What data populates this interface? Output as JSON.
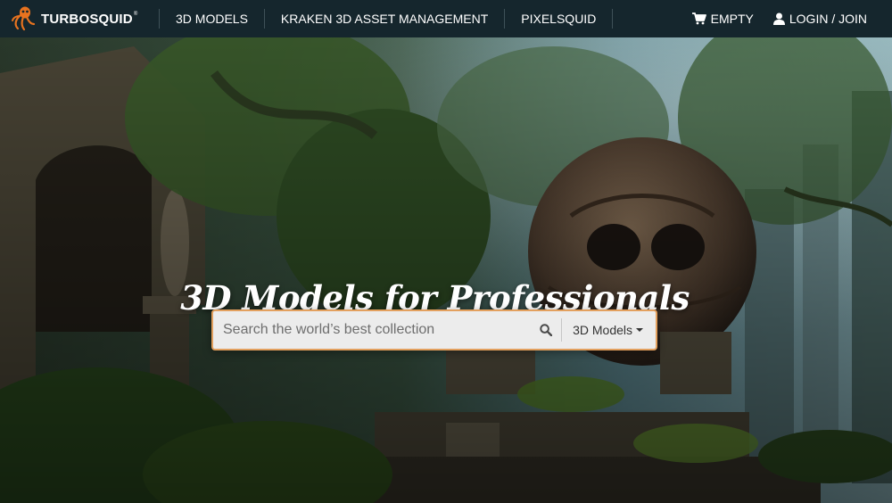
{
  "header": {
    "brand": "TURBOSQUID",
    "brand_mark": "®",
    "nav": [
      {
        "label": "3D MODELS"
      },
      {
        "label": "KRAKEN 3D ASSET MANAGEMENT"
      },
      {
        "label": "PIXELSQUID"
      }
    ],
    "cart_label": "EMPTY",
    "login_label": "LOGIN / JOIN"
  },
  "hero": {
    "headline": "3D Models for Professionals",
    "search": {
      "placeholder": "Search the world’s best collection",
      "category": "3D Models"
    }
  },
  "colors": {
    "header_bg": "#15262d",
    "logo_accent": "#e8731f",
    "search_border": "#e3a05e"
  },
  "icons": {
    "logo": "squid-icon",
    "cart": "shopping-cart-icon",
    "user": "user-icon",
    "search": "magnifier-icon",
    "dropdown": "caret-down-icon"
  }
}
